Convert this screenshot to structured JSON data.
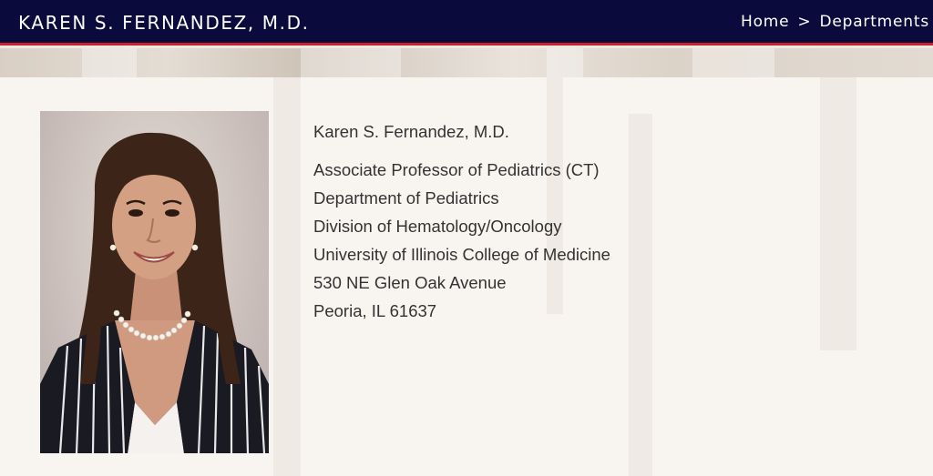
{
  "header": {
    "site_title": "KAREN S. FERNANDEZ, M.D.",
    "breadcrumb": {
      "home": "Home",
      "separator": ">",
      "departments": "Departments"
    }
  },
  "profile": {
    "photo_alt": "Karen S. Fernandez, M.D.",
    "name": "Karen S. Fernandez, M.D.",
    "title": "Associate Professor of Pediatrics (CT)",
    "department": "Department of Pediatrics",
    "division": "Division of Hematology/Oncology",
    "institution": "University of Illinois College of Medicine",
    "street": "530 NE Glen Oak Avenue",
    "city_state_zip": "Peoria, IL 61637"
  },
  "colors": {
    "header_bg": "#0a0a3c",
    "header_accent": "#c8202f",
    "text": "#333333"
  }
}
